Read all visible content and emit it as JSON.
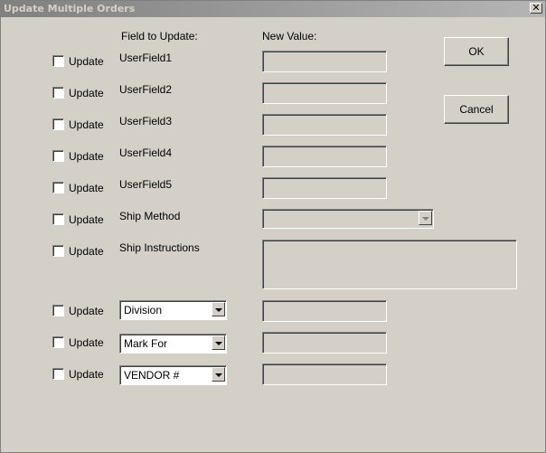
{
  "window": {
    "title": "Update Multiple Orders",
    "close_glyph": "✕"
  },
  "headers": {
    "field": "Field to Update:",
    "value": "New Value:"
  },
  "checkbox_label": "Update",
  "fields": [
    {
      "label": "UserField1",
      "checked": false,
      "value": ""
    },
    {
      "label": "UserField2",
      "checked": false,
      "value": ""
    },
    {
      "label": "UserField3",
      "checked": false,
      "value": ""
    },
    {
      "label": "UserField4",
      "checked": false,
      "value": ""
    },
    {
      "label": "UserField5",
      "checked": false,
      "value": ""
    },
    {
      "label": "Ship Method",
      "checked": false,
      "value": ""
    },
    {
      "label": "Ship Instructions",
      "checked": false,
      "value": ""
    }
  ],
  "selectable_fields": [
    {
      "selected": "Division",
      "checked": false,
      "value": ""
    },
    {
      "selected": "Mark For",
      "checked": false,
      "value": ""
    },
    {
      "selected": "VENDOR #",
      "checked": false,
      "value": ""
    }
  ],
  "buttons": {
    "ok": "OK",
    "cancel": "Cancel"
  },
  "colors": {
    "face": "#d4d0c8",
    "title_bar_start": "#808080",
    "title_bar_end": "#b5b5b5"
  },
  "icons": {
    "close": "close-icon",
    "dropdown": "chevron-down-icon"
  }
}
